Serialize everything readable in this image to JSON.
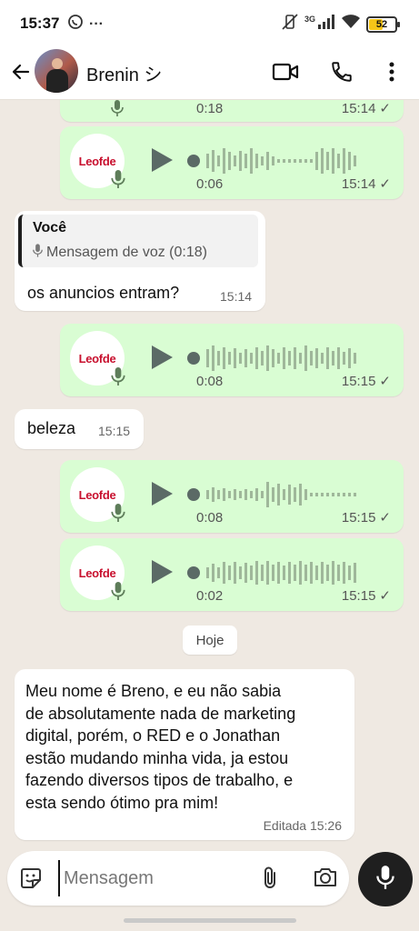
{
  "status_bar": {
    "time": "15:37",
    "more": "···",
    "network": "3G",
    "battery": "52"
  },
  "header": {
    "contact_name": "Brenin シ",
    "icons": [
      "back-arrow-icon",
      "video-call-icon",
      "phone-icon",
      "more-vert-icon"
    ]
  },
  "colors": {
    "outgoing_bubble": "#d9fdd3",
    "incoming_bubble": "#ffffff",
    "chat_background": "#efe9e2",
    "tick": "#667781",
    "waveform": "#b8c9b3"
  },
  "voice_avatar_logo": "Leofde",
  "messages": {
    "voice_top_partial": {
      "duration": "0:18",
      "time": "15:14"
    },
    "voice_1": {
      "duration": "0:06",
      "time": "15:14"
    },
    "reply": {
      "quote_author": "Você",
      "quote_body": "Mensagem de voz (0:18)",
      "text": "os anuncios entram?",
      "time": "15:14"
    },
    "voice_2": {
      "duration": "0:08",
      "time": "15:15"
    },
    "beleza": {
      "text": "beleza",
      "time": "15:15"
    },
    "voice_3": {
      "duration": "0:08",
      "time": "15:15"
    },
    "voice_4": {
      "duration": "0:02",
      "time": "15:15"
    },
    "day_divider": "Hoje",
    "long_message": {
      "lines": [
        "Meu nome é Breno, e eu não sabia",
        "de absolutamente nada de marketing",
        "digital, porém, o RED e o Jonathan",
        "estão mudando minha vida, ja estou",
        "fazendo diversos tipos de trabalho, e",
        "esta sendo ótimo pra mim!"
      ],
      "edited_label": "Editada",
      "time": "15:26"
    }
  },
  "composer": {
    "placeholder": "Mensagem"
  }
}
